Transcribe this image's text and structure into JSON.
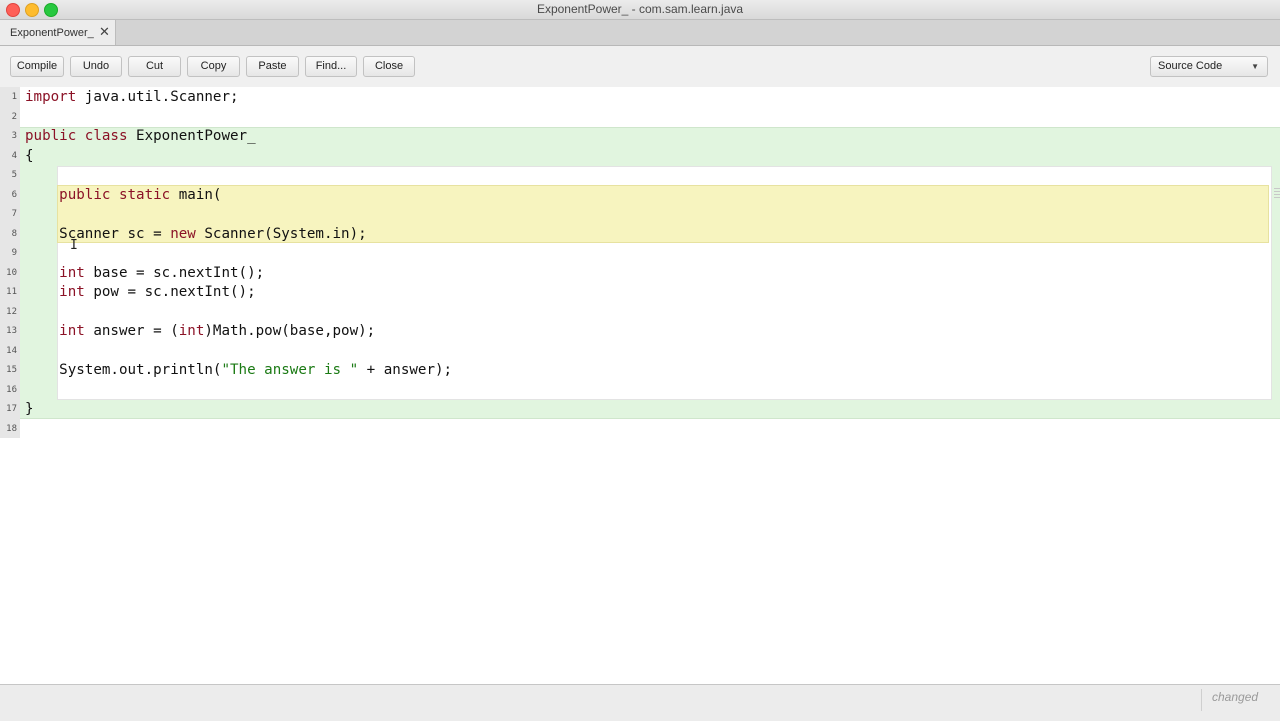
{
  "window": {
    "title": "ExponentPower_ - com.sam.learn.java"
  },
  "tabs": [
    {
      "label": "ExponentPower_"
    }
  ],
  "toolbar": {
    "buttons": [
      "Compile",
      "Undo",
      "Cut",
      "Copy",
      "Paste",
      "Find...",
      "Close"
    ],
    "view_select": "Source Code"
  },
  "editor": {
    "lines": [
      [
        {
          "t": "import",
          "k": "kw"
        },
        {
          "t": " java.util.Scanner;"
        }
      ],
      [],
      [
        {
          "t": "public",
          "k": "kw"
        },
        {
          "t": " "
        },
        {
          "t": "class",
          "k": "kw"
        },
        {
          "t": " ExponentPower_"
        }
      ],
      [
        {
          "t": "{"
        }
      ],
      [],
      [
        {
          "t": "    "
        },
        {
          "t": "public",
          "k": "kw"
        },
        {
          "t": " "
        },
        {
          "t": "static",
          "k": "kw"
        },
        {
          "t": " main("
        }
      ],
      [],
      [
        {
          "t": "    Scanner sc = "
        },
        {
          "t": "new",
          "k": "kw"
        },
        {
          "t": " Scanner(System.in);"
        }
      ],
      [],
      [
        {
          "t": "    "
        },
        {
          "t": "int",
          "k": "kw"
        },
        {
          "t": " base = sc.nextInt();"
        }
      ],
      [
        {
          "t": "    "
        },
        {
          "t": "int",
          "k": "kw"
        },
        {
          "t": " pow = sc.nextInt();"
        }
      ],
      [],
      [
        {
          "t": "    "
        },
        {
          "t": "int",
          "k": "kw"
        },
        {
          "t": " answer = ("
        },
        {
          "t": "int",
          "k": "kw"
        },
        {
          "t": ")Math.pow(base,pow);"
        }
      ],
      [],
      [
        {
          "t": "    System.out.println("
        },
        {
          "t": "\"The answer is \"",
          "k": "str"
        },
        {
          "t": " + answer);"
        }
      ],
      [],
      [
        {
          "t": "}"
        }
      ],
      []
    ]
  },
  "status": {
    "text": "changed"
  },
  "colors": {
    "keyword": "#8b1226",
    "string": "#1b7a14",
    "class_scope": "#e1f5df",
    "method_scope": "#f7f4bf"
  }
}
